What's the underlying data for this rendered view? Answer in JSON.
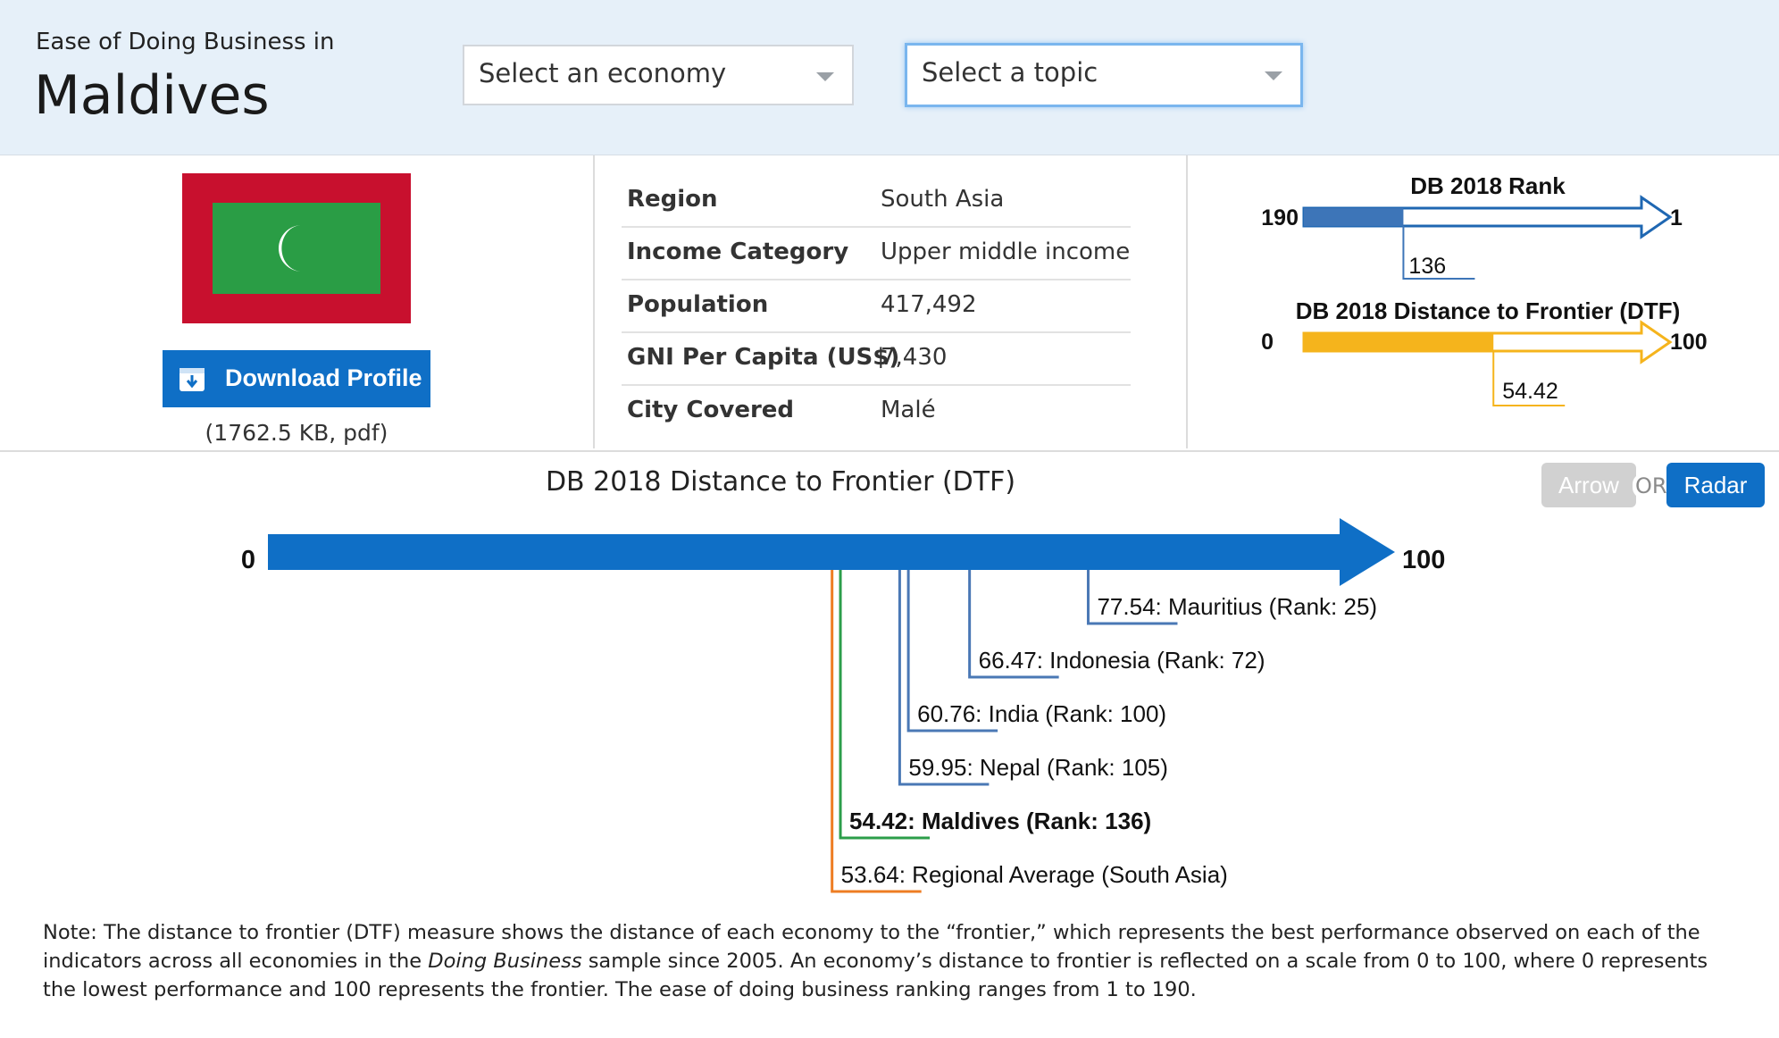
{
  "header": {
    "subtitle": "Ease of Doing Business in",
    "economy": "Maldives",
    "economy_select": {
      "placeholder": "Select an economy"
    },
    "topic_select": {
      "placeholder": "Select a topic"
    }
  },
  "profile": {
    "download_label": "Download Profile",
    "file_info": "(1762.5 KB, pdf)",
    "flag_colors": {
      "border": "#c8102e",
      "field": "#2a9d45",
      "crescent": "#ffffff"
    }
  },
  "info": [
    {
      "key": "Region",
      "value": "South Asia"
    },
    {
      "key": "Income Category",
      "value": "Upper middle income"
    },
    {
      "key": "Population",
      "value": "417,492"
    },
    {
      "key": "GNI Per Capita (US$)",
      "value": "7,430"
    },
    {
      "key": "City Covered",
      "value": "Malé"
    }
  ],
  "rank_mini": {
    "title": "DB 2018 Rank",
    "min_label": "190",
    "max_label": "1",
    "value": 136,
    "value_label": "136",
    "color": "#3d75b8"
  },
  "dtf_mini": {
    "title": "DB 2018 Distance to Frontier (DTF)",
    "min_label": "0",
    "max_label": "100",
    "value": 54.42,
    "value_label": "54.42",
    "color": "#f5b41c"
  },
  "toggle": {
    "arrow": "Arrow",
    "or": "OR",
    "radar": "Radar"
  },
  "chart_data": {
    "type": "bar",
    "title": "DB 2018 Distance to Frontier (DTF)",
    "xlim": [
      0,
      100
    ],
    "min_label": "0",
    "max_label": "100",
    "arrow_color": "#0f6fc6",
    "markers": [
      {
        "value": 77.54,
        "label": "77.54: Mauritius (Rank: 25)",
        "color": "#4a78b5",
        "bold": false
      },
      {
        "value": 66.47,
        "label": "66.47: Indonesia (Rank: 72)",
        "color": "#4a78b5",
        "bold": false
      },
      {
        "value": 60.76,
        "label": "60.76: India (Rank: 100)",
        "color": "#4a78b5",
        "bold": false
      },
      {
        "value": 59.95,
        "label": "59.95: Nepal (Rank: 105)",
        "color": "#4a78b5",
        "bold": false
      },
      {
        "value": 54.42,
        "label": "54.42: Maldives (Rank: 136)",
        "color": "#2c9e4a",
        "bold": true
      },
      {
        "value": 53.64,
        "label": "53.64: Regional Average (South Asia)",
        "color": "#ee7d23",
        "bold": false
      }
    ]
  },
  "note": {
    "part1": "Note: The distance to frontier (DTF) measure shows the distance of each economy to the “frontier,” which represents the best performance observed on each of the indicators across all economies in the ",
    "italic": "Doing Business",
    "part2": " sample since 2005. An economy’s distance to frontier is reflected on a scale from 0 to 100, where 0 represents the lowest performance and 100 represents the frontier. The ease of doing business ranking ranges from 1 to 190."
  }
}
